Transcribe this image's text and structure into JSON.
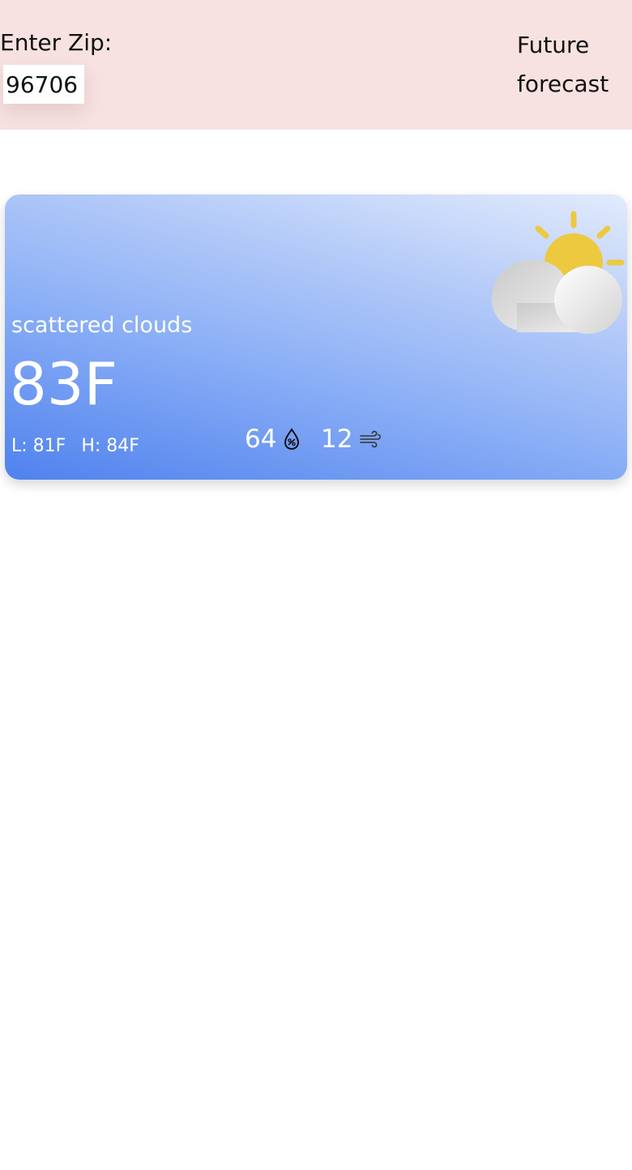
{
  "search": {
    "label": "Enter Zip:",
    "zip_value": "96706"
  },
  "nav": {
    "future_forecast_label": "Future forecast"
  },
  "current_weather": {
    "description": "scattered clouds",
    "temperature": "83F",
    "low": "L: 81F",
    "high": "H: 84F",
    "humidity": "64",
    "wind_speed": "12",
    "condition_icon": "partly-cloudy-icon",
    "humidity_icon": "humidity-drop-icon",
    "wind_icon": "wind-icon"
  },
  "colors": {
    "header_background": "#f7e2e1",
    "card_gradient_start": "#4f82ee",
    "card_gradient_end": "#e2ebfc",
    "sun": "#ecc93f"
  }
}
